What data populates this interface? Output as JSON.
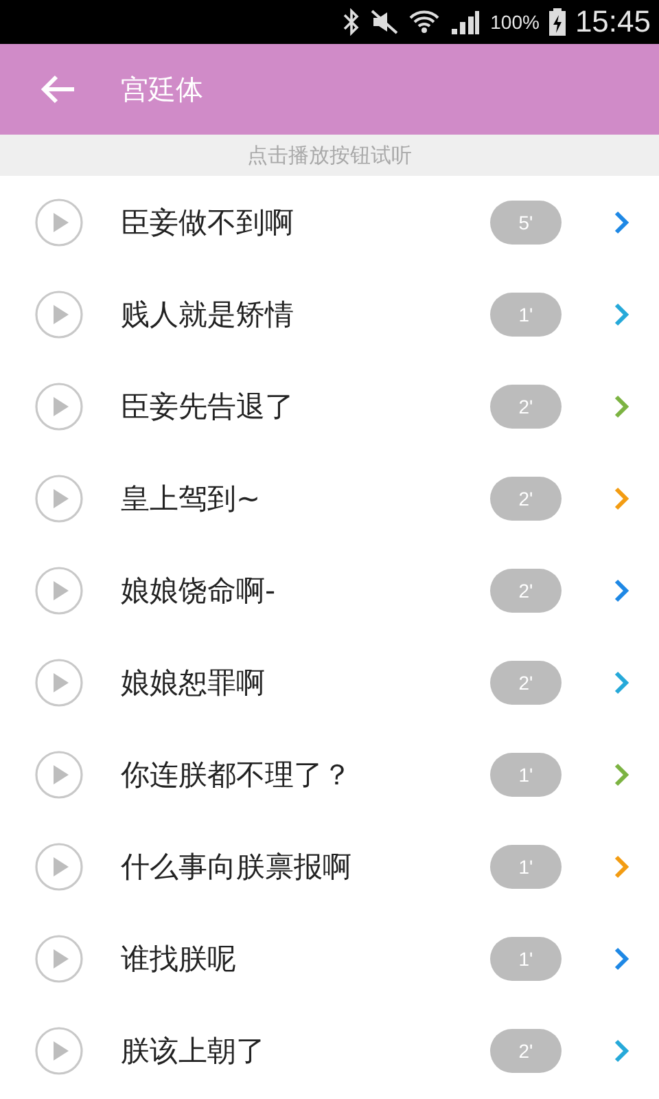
{
  "status_bar": {
    "battery": "100%",
    "time": "15:45"
  },
  "toolbar": {
    "title": "宫廷体"
  },
  "hint": "点击播放按钮试听",
  "items": [
    {
      "title": "臣妾做不到啊",
      "duration": "5'",
      "color": "#1e88e5"
    },
    {
      "title": "贱人就是矫情",
      "duration": "1'",
      "color": "#26a9d9"
    },
    {
      "title": "臣妾先告退了",
      "duration": "2'",
      "color": "#7cb342"
    },
    {
      "title": "皇上驾到~",
      "duration": "2'",
      "color": "#f39c12"
    },
    {
      "title": "娘娘饶命啊-",
      "duration": "2'",
      "color": "#1e88e5"
    },
    {
      "title": "娘娘恕罪啊",
      "duration": "2'",
      "color": "#26a9d9"
    },
    {
      "title": "你连朕都不理了？",
      "duration": "1'",
      "color": "#7cb342"
    },
    {
      "title": "什么事向朕禀报啊",
      "duration": "1'",
      "color": "#f39c12"
    },
    {
      "title": "谁找朕呢",
      "duration": "1'",
      "color": "#1e88e5"
    },
    {
      "title": "朕该上朝了",
      "duration": "2'",
      "color": "#26a9d9"
    }
  ]
}
